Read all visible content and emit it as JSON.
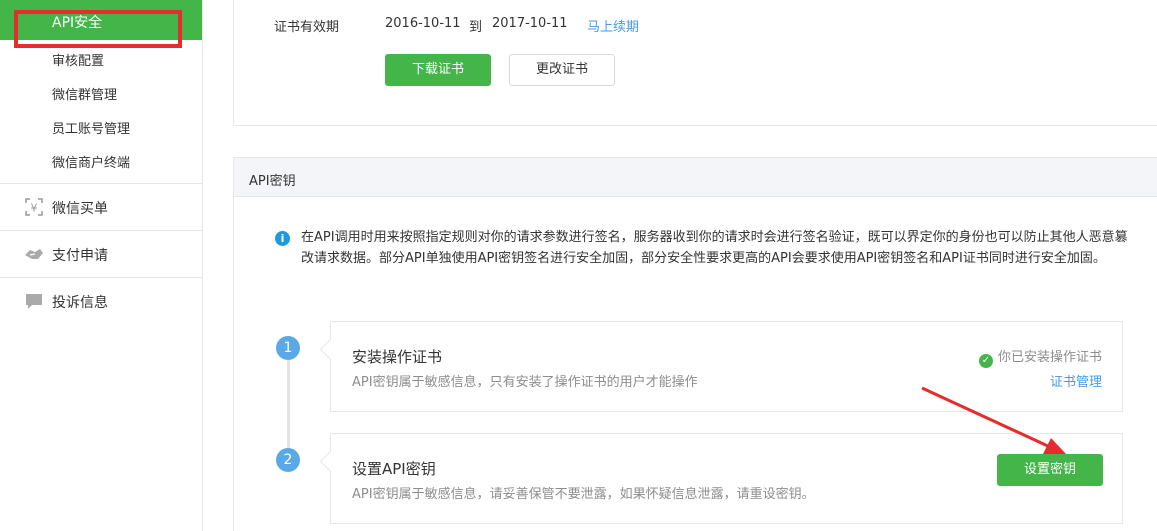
{
  "sidebar": {
    "active_item": "API安全",
    "sub_items": [
      "审核配置",
      "微信群管理",
      "员工账号管理",
      "微信商户终端"
    ],
    "groups": [
      {
        "label": "微信买单",
        "icon": "yuan-scan-icon"
      },
      {
        "label": "支付申请",
        "icon": "handshake-icon"
      },
      {
        "label": "投诉信息",
        "icon": "chat-bubble-icon"
      }
    ]
  },
  "cert": {
    "label": "证书有效期",
    "start": "2016-10-11",
    "to": "到",
    "end": "2017-10-11",
    "renew": "马上续期",
    "download_btn": "下载证书",
    "change_btn": "更改证书"
  },
  "api_key": {
    "section_title": "API密钥",
    "info_icon": "i",
    "info": "在API调用时用来按照指定规则对你的请求参数进行签名，服务器收到你的请求时会进行签名验证，既可以界定你的身份也可以防止其他人恶意篡改请求数据。部分API单独使用API密钥签名进行安全加固，部分安全性要求更高的API会要求使用API密钥签名和API证书同时进行安全加固。",
    "steps": [
      {
        "num": "1",
        "title": "安装操作证书",
        "desc": "API密钥属于敏感信息，只有安装了操作证书的用户才能操作",
        "status": "你已安装操作证书",
        "link": "证书管理"
      },
      {
        "num": "2",
        "title": "设置API密钥",
        "desc": "API密钥属于敏感信息，请妥善保管不要泄露，如果怀疑信息泄露，请重设密钥。",
        "button": "设置密钥"
      }
    ]
  },
  "colors": {
    "brand_green": "#44b549",
    "link_blue": "#459ae9",
    "highlight_red": "#e62c2c",
    "step_blue": "#5aa9e6"
  }
}
